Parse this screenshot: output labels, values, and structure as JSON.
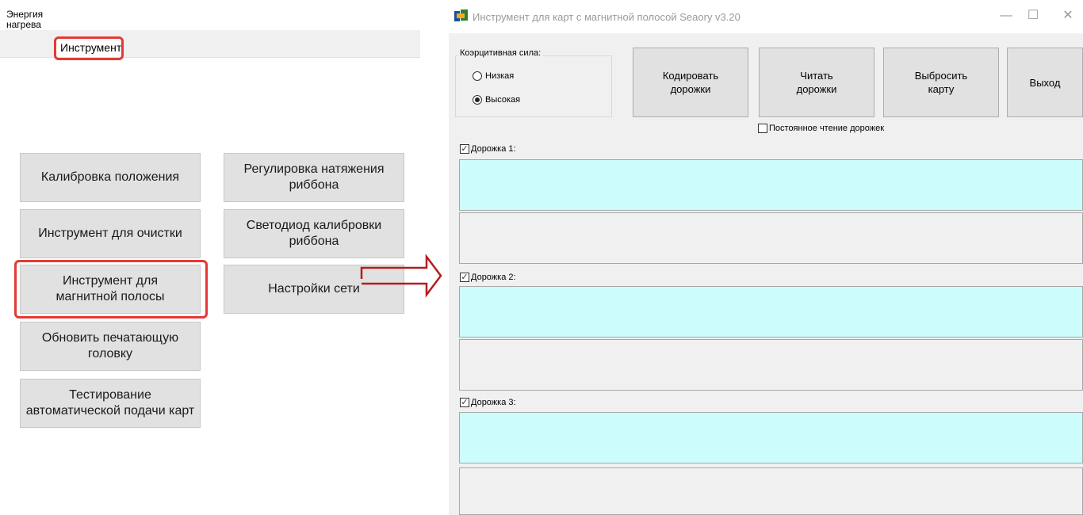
{
  "left_panel": {
    "tabs": [
      {
        "label": "Энергия\nнагрева"
      },
      {
        "label": "Инструмент"
      }
    ],
    "buttons": {
      "calibration": "Калибровка положения",
      "ribbon_tension": "Регулировка натяжения\nриббона",
      "cleaning": "Инструмент для очистки",
      "ribbon_led": "Светодиод калибровки\nриббона",
      "mag_stripe": "Инструмент для\nмагнитной полосы",
      "network": "Настройки сети",
      "printhead": "Обновить печатающую\nголовку",
      "autofeed": "Тестирование\nавтоматической подачи карт"
    },
    "highlight_color": "#e53935",
    "arrow_color": "#b71c1c"
  },
  "window": {
    "title": "Инструмент для карт с магнитной полосой Seaory v3.20",
    "controls": {
      "minimize": "—",
      "maximize": "☐",
      "close": "✕"
    },
    "coercivity": {
      "label": "Коэрцитивная сила:",
      "options": [
        {
          "label": "Низкая",
          "selected": false
        },
        {
          "label": "Высокая",
          "selected": true
        }
      ]
    },
    "actions": {
      "encode": "Кодировать\nдорожки",
      "read": "Читать\nдорожки",
      "eject": "Выбросить\nкарту",
      "exit": "Выход"
    },
    "continuous_read": {
      "label": "Постоянное чтение дорожек",
      "checked": false
    },
    "tracks": [
      {
        "label": "Дорожка 1:",
        "checked": true,
        "value": ""
      },
      {
        "label": "Дорожка 2:",
        "checked": true,
        "value": ""
      },
      {
        "label": "Дорожка 3:",
        "checked": true,
        "value": ""
      }
    ],
    "check_mark": "✓",
    "track_color": "#ccfcfc"
  }
}
